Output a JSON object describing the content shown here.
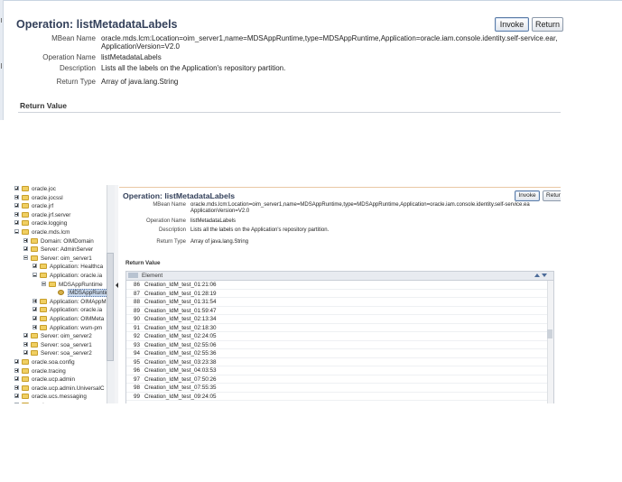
{
  "top": {
    "title": "Operation: listMetadataLabels",
    "invoke_label": "Invoke",
    "return_label": "Return",
    "fields": [
      {
        "label": "MBean Name",
        "value_line1": "oracle.mds.lcm:Location=oim_server1,name=MDSAppRuntime,type=MDSAppRuntime,Application=oracle.iam.console.identity.self-service.ear,",
        "value_line2": "ApplicationVersion=V2.0"
      },
      {
        "label": "Operation Name",
        "value_line1": "listMetadataLabels"
      },
      {
        "label": "Description",
        "value_line1": "Lists all the labels on the Application's repository partition."
      },
      {
        "label": "Return Type",
        "value_line1": "Array of java.lang.String"
      }
    ],
    "return_value_label": "Return Value"
  },
  "tree": {
    "items": [
      {
        "label": "oracle.joc",
        "expander": "plus",
        "icon": "folder-icon"
      },
      {
        "label": "oracle.jocssl",
        "expander": "plus",
        "icon": "folder-icon"
      },
      {
        "label": "oracle.jrf",
        "expander": "plus",
        "icon": "folder-icon"
      },
      {
        "label": "oracle.jrf.server",
        "expander": "plus",
        "icon": "folder-icon"
      },
      {
        "label": "oracle.logging",
        "expander": "plus",
        "icon": "folder-icon"
      },
      {
        "label": "oracle.mds.lcm",
        "expander": "minus",
        "icon": "folder-icon"
      },
      {
        "label": "Domain: OIMDomain",
        "expander": "plus",
        "icon": "folder-icon"
      },
      {
        "label": "Server: AdminServer",
        "expander": "plus",
        "icon": "folder-icon"
      },
      {
        "label": "Server: oim_server1",
        "expander": "minus",
        "icon": "folder-icon"
      },
      {
        "label": "Application: Healthca",
        "expander": "plus",
        "icon": "folder-icon"
      },
      {
        "label": "Application: oracle.ia",
        "expander": "minus",
        "icon": "folder-icon"
      },
      {
        "label": "MDSAppRuntime",
        "expander": "minus",
        "icon": "folder-icon"
      },
      {
        "label": "MDSAppRuntim",
        "expander": "none",
        "icon": "bean-icon",
        "selected": true
      },
      {
        "label": "Application: OIMAppM",
        "expander": "plus",
        "icon": "folder-icon"
      },
      {
        "label": "Application: oracle.ia",
        "expander": "plus",
        "icon": "folder-icon"
      },
      {
        "label": "Application: OIMMeta",
        "expander": "plus",
        "icon": "folder-icon"
      },
      {
        "label": "Application: wsm-pm",
        "expander": "plus",
        "icon": "folder-icon"
      },
      {
        "label": "Server: oim_server2",
        "expander": "plus",
        "icon": "folder-icon"
      },
      {
        "label": "Server: soa_server1",
        "expander": "plus",
        "icon": "folder-icon"
      },
      {
        "label": "Server: soa_server2",
        "expander": "plus",
        "icon": "folder-icon"
      },
      {
        "label": "oracle.soa.config",
        "expander": "plus",
        "icon": "folder-icon"
      },
      {
        "label": "oracle.tracing",
        "expander": "plus",
        "icon": "folder-icon"
      },
      {
        "label": "oracle.ucp.admin",
        "expander": "plus",
        "icon": "folder-icon"
      },
      {
        "label": "oracle.ucp.admin.UniversalC",
        "expander": "plus",
        "icon": "folder-icon"
      },
      {
        "label": "oracle.ucs.messaging",
        "expander": "plus",
        "icon": "folder-icon"
      },
      {
        "label": "oracle.wsm",
        "expander": "plus",
        "icon": "folder-icon"
      }
    ]
  },
  "bottom": {
    "title": "Operation: listMetadataLabels",
    "invoke_label": "Invoke",
    "return_label": "Retur",
    "fields": [
      {
        "label": "MBean Name",
        "value_line1": "oracle.mds.lcm:Location=oim_server1,name=MDSAppRuntime,type=MDSAppRuntime,Application=oracle.iam.console.identity.self-service.ea",
        "value_line2": "ApplicationVersion=V2.0"
      },
      {
        "label": "Operation Name",
        "value_line1": "listMetadataLabels"
      },
      {
        "label": "Description",
        "value_line1": "Lists all the labels on the Application's repository partition."
      },
      {
        "label": "Return Type",
        "value_line1": "Array of java.lang.String"
      }
    ],
    "return_value_label": "Return Value",
    "table": {
      "column_header": "Element",
      "rows": [
        {
          "num": "86",
          "value": "Creation_IdM_test_01:21:06"
        },
        {
          "num": "87",
          "value": "Creation_IdM_test_01:28:19"
        },
        {
          "num": "88",
          "value": "Creation_IdM_test_01:31:54"
        },
        {
          "num": "89",
          "value": "Creation_IdM_test_01:59:47"
        },
        {
          "num": "90",
          "value": "Creation_IdM_test_02:13:34"
        },
        {
          "num": "91",
          "value": "Creation_IdM_test_02:18:30"
        },
        {
          "num": "92",
          "value": "Creation_IdM_test_02:24:05"
        },
        {
          "num": "93",
          "value": "Creation_IdM_test_02:55:06"
        },
        {
          "num": "94",
          "value": "Creation_IdM_test_02:55:36"
        },
        {
          "num": "95",
          "value": "Creation_IdM_test_03:23:38"
        },
        {
          "num": "96",
          "value": "Creation_IdM_test_04:03:53"
        },
        {
          "num": "97",
          "value": "Creation_IdM_test_07:50:26"
        },
        {
          "num": "98",
          "value": "Creation_IdM_test_07:55:35"
        },
        {
          "num": "99",
          "value": "Creation_IdM_test_09:24:05"
        }
      ]
    }
  },
  "colors": {
    "title": "#33405a",
    "accent_line": "#e9c8a4",
    "selection": "#c9d9ee",
    "folder": "#f0cf62"
  }
}
